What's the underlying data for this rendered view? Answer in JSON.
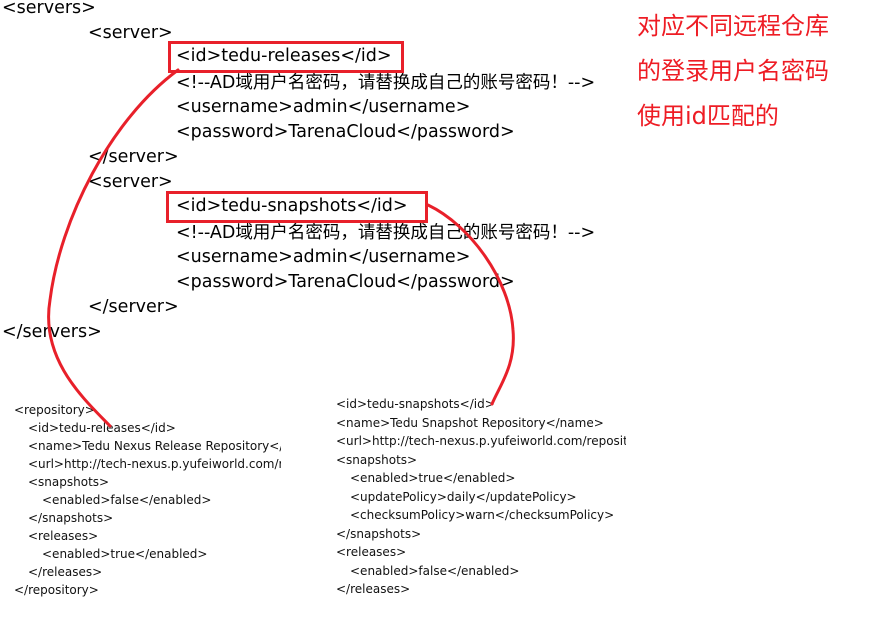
{
  "servers_xml": {
    "lines": [
      "<servers>",
      "<server>",
      "<id>tedu-releases</id>",
      "<!--AD域用户名密码，请替换成自己的账号密码！-->",
      "<username>admin</username>",
      "<password>TarenaCloud</password>",
      "</server>",
      "<server>",
      "<id>tedu-snapshots</id>",
      "<!--AD域用户名密码，请替换成自己的账号密码！-->",
      "<username>admin</username>",
      "<password>TarenaCloud</password>",
      "</server>",
      "</servers>"
    ]
  },
  "annotation": {
    "lines": [
      "对应不同远程仓库",
      "的登录用户名密码",
      "使用id匹配的"
    ],
    "color": "#ee1c24"
  },
  "repo_releases": {
    "lines": [
      "<repository>",
      "<id>tedu-releases</id>",
      "<name>Tedu Nexus Release Repository</name>",
      "<url>http://tech-nexus.p.yufeiworld.com/repository/",
      "<snapshots>",
      "<enabled>false</enabled>",
      "</snapshots>",
      "<releases>",
      "<enabled>true</enabled>",
      "</releases>",
      "</repository>"
    ]
  },
  "repo_snapshots": {
    "lines": [
      "<id>tedu-snapshots</id>",
      "<name>Tedu Snapshot Repository</name>",
      "<url>http://tech-nexus.p.yufeiworld.com/repository/",
      "<snapshots>",
      "<enabled>true</enabled>",
      "<updatePolicy>daily</updatePolicy>",
      "<checksumPolicy>warn</checksumPolicy>",
      "</snapshots>",
      "<releases>",
      "<enabled>false</enabled>",
      "</releases>"
    ]
  },
  "highlight_color": "#e8202a"
}
